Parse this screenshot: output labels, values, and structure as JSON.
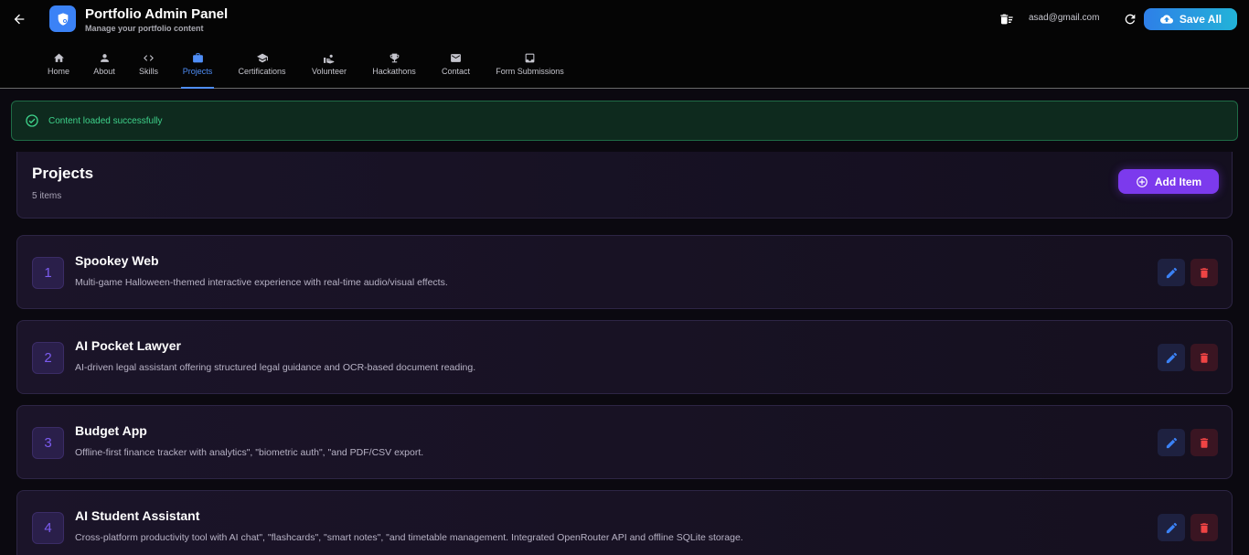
{
  "header": {
    "title": "Portfolio Admin Panel",
    "subtitle": "Manage your portfolio content",
    "user_email": "asad@gmail.com",
    "save_label": "Save All"
  },
  "tabs": [
    {
      "label": "Home",
      "icon": "home-icon"
    },
    {
      "label": "About",
      "icon": "person-icon"
    },
    {
      "label": "Skills",
      "icon": "code-icon"
    },
    {
      "label": "Projects",
      "icon": "briefcase-icon",
      "active": true
    },
    {
      "label": "Certifications",
      "icon": "graduation-cap-icon"
    },
    {
      "label": "Volunteer",
      "icon": "volunteer-hand-icon"
    },
    {
      "label": "Hackathons",
      "icon": "trophy-icon"
    },
    {
      "label": "Contact",
      "icon": "mail-icon"
    },
    {
      "label": "Form Submissions",
      "icon": "inbox-icon"
    }
  ],
  "alert": {
    "message": "Content loaded successfully"
  },
  "section": {
    "title": "Projects",
    "count": "5 items",
    "add_label": "Add Item"
  },
  "projects": [
    {
      "num": "1",
      "title": "Spookey Web",
      "desc": "Multi-game Halloween-themed interactive experience with real-time audio/visual effects."
    },
    {
      "num": "2",
      "title": "AI Pocket Lawyer",
      "desc": "AI-driven legal assistant offering structured legal guidance and OCR-based document reading."
    },
    {
      "num": "3",
      "title": "Budget App",
      "desc": "Offline-first finance tracker with analytics\", \"biometric auth\", \"and PDF/CSV export."
    },
    {
      "num": "4",
      "title": "AI Student Assistant",
      "desc": "Cross-platform productivity tool with AI chat\", \"flashcards\", \"smart notes\", \"and timetable management. Integrated OpenRouter API and offline SQLite storage."
    }
  ],
  "colors": {
    "accent_blue": "#4f8ef7",
    "accent_purple": "#7c3aed",
    "success_green": "#3ed18a",
    "danger_red": "#ef4444"
  }
}
